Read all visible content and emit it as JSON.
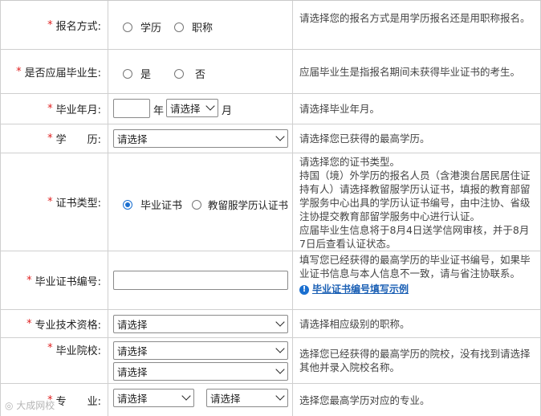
{
  "rows": {
    "apply_method": {
      "label": "报名方式:",
      "options": [
        "学历",
        "职称"
      ],
      "hint": "请选择您的报名方式是用学历报名还是用职称报名。"
    },
    "fresh_graduate": {
      "label": "是否应届毕业生:",
      "options": [
        "是",
        "否"
      ],
      "hint": "应届毕业生是指报名期间未获得毕业证书的考生。"
    },
    "grad_date": {
      "label": "毕业年月:",
      "year_value": "",
      "year_unit": "年",
      "month_select": "请选择",
      "month_unit": "月",
      "hint": "请选择毕业年月。"
    },
    "education": {
      "label": "学　　历:",
      "select": "请选择",
      "hint": "请选择您已获得的最高学历。"
    },
    "cert_type": {
      "label": "证书类型:",
      "options": [
        "毕业证书",
        "教留服学历认证书"
      ],
      "selected": "毕业证书",
      "hint_lines": [
        "请选择您的证书类型。",
        "持国（境）外学历的报名人员（含港澳台居民居住证持有人）请选择教留服学历认证书，填报的教育部留学服务中心出具的学历认证书编号，由中注协、省级注协提交教育部留学服务中心进行认证。",
        "应届毕业生信息将于8月4日送学信网审核，并于8月7日后查看认证状态。"
      ]
    },
    "cert_number": {
      "label": "毕业证书编号:",
      "value": "",
      "hint": "填写您已经获得的最高学历的毕业证书编号，如果毕业证书信息与本人信息不一致，请与省注协联系。",
      "link": "毕业证书编号填写示例"
    },
    "pro_qualification": {
      "label": "专业技术资格:",
      "select": "请选择",
      "hint": "请选择相应级别的职称。"
    },
    "school": {
      "label": "毕业院校:",
      "select1": "请选择",
      "select2": "请选择",
      "hint": "选择您已经获得的最高学历的院校，没有找到请选择其他并录入院校名称。"
    },
    "major": {
      "label": "专　　业:",
      "select1": "请选择",
      "select2": "请选择",
      "hint": "选择您最高学历对应的专业。"
    }
  },
  "required_mark": "*",
  "watermark": "大成网校",
  "colors": {
    "required": "#e02020",
    "accent": "#1a6fd0",
    "link": "#1a5fb4"
  }
}
